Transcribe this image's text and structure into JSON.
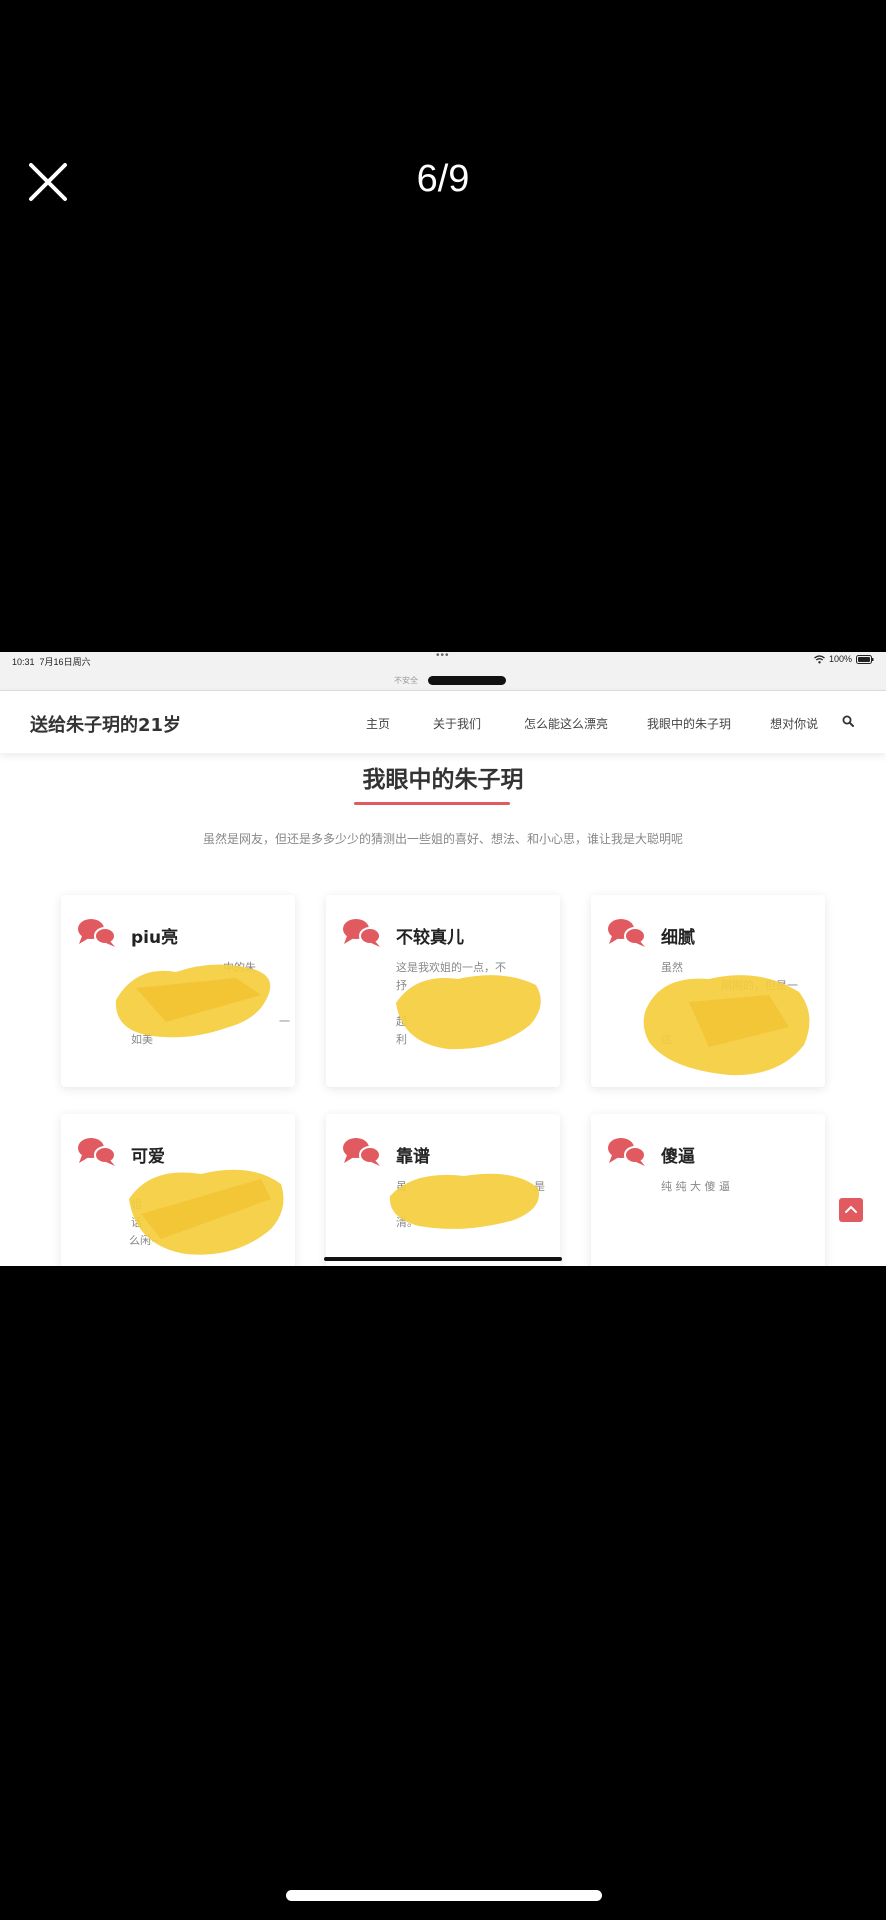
{
  "viewer": {
    "counter": "6/9"
  },
  "status": {
    "time": "10:31",
    "date": "7月16日周六",
    "battery": "100%"
  },
  "url": {
    "insecure_label": "不安全"
  },
  "site": {
    "brand": "送给朱子玥的21岁",
    "menu": [
      "主页",
      "关于我们",
      "怎么能这么漂亮",
      "我眼中的朱子玥",
      "想对你说"
    ]
  },
  "section": {
    "title": "我眼中的朱子玥",
    "subtitle": "虽然是网友，但还是多多少少的猜测出一些姐的喜好、想法、和小心思，谁让我是大聪明呢"
  },
  "cards": [
    {
      "title": "piu亮",
      "text": [
        "中的朱",
        "",
        "",
        "一",
        "如美"
      ]
    },
    {
      "title": "不较真儿",
      "text": [
        "这是我欢姐的一点，不",
        "抒",
        "",
        "起",
        "利"
      ]
    },
    {
      "title": "细腻",
      "text": [
        "虽然",
        "刚刚的，但是一",
        "",
        "",
        "这"
      ]
    },
    {
      "title": "可爱",
      "text": [
        "",
        "姐",
        "话",
        "么闲~"
      ]
    },
    {
      "title": "靠谱",
      "text": [
        "虽",
        "是",
        "清。",
        "的"
      ]
    },
    {
      "title": "傻逼",
      "text": [
        "纯 纯 大 傻 逼"
      ]
    }
  ],
  "colors": {
    "accent": "#e05a5f",
    "scribble": "#f5cd3d"
  },
  "icons": [
    "close-icon",
    "wifi-icon",
    "battery-icon",
    "search-icon",
    "chat-bubbles-icon",
    "arrow-up-icon"
  ]
}
